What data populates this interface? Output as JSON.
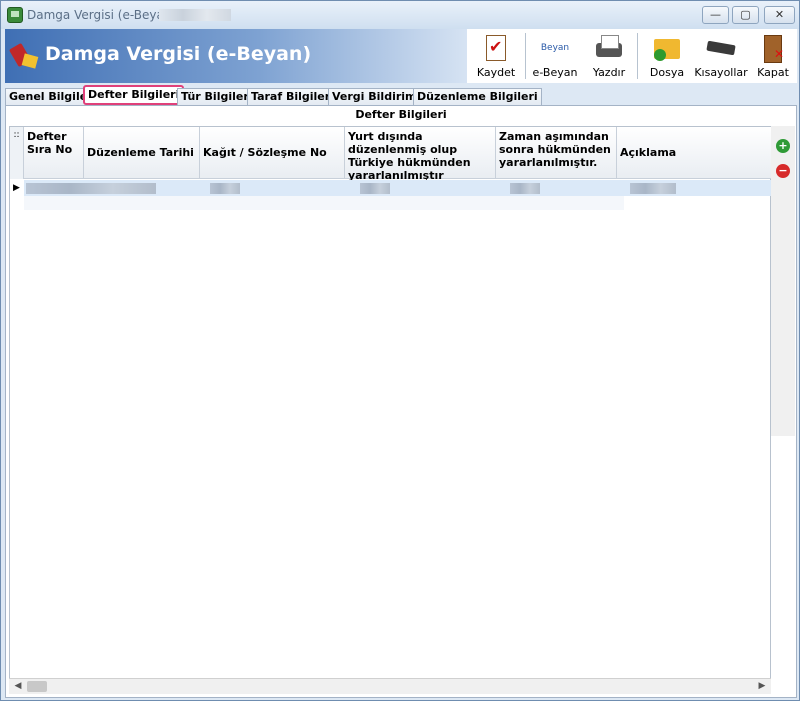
{
  "window": {
    "title": "Damga Vergisi (e-Beyan)",
    "min_glyph": "—",
    "max_glyph": "▢",
    "close_glyph": "✕"
  },
  "banner": {
    "title": "Damga Vergisi (e-Beyan)"
  },
  "toolbar": {
    "items": [
      {
        "label": "Kaydet",
        "icon": "save-icon"
      },
      {
        "label": "e-Beyan",
        "icon": "ebeyan-icon",
        "icon_text": "Beyan"
      },
      {
        "label": "Yazdır",
        "icon": "printer-icon"
      },
      {
        "label": "Dosya",
        "icon": "folder-icon"
      },
      {
        "label": "Kısayollar",
        "icon": "keyboard-icon"
      },
      {
        "label": "Kapat",
        "icon": "exit-icon"
      }
    ]
  },
  "tabs": [
    {
      "label": "Genel Bilgiler"
    },
    {
      "label": "Defter Bilgileri",
      "active": true
    },
    {
      "label": "Tür Bilgileri"
    },
    {
      "label": "Taraf Bilgileri"
    },
    {
      "label": "Vergi Bildirimi"
    },
    {
      "label": "Düzenleme Bilgileri"
    }
  ],
  "section": {
    "title": "Defter Bilgileri"
  },
  "grid": {
    "corner": "::",
    "columns": [
      "Defter Sıra No",
      "Düzenleme Tarihi",
      "Kağıt / Sözleşme No",
      "Yurt dışında düzenlenmiş olup Türkiye hükmünden yararlanılmıştır",
      "Zaman aşımından sonra hükmünden yararlanılmıştır.",
      "Açıklama"
    ],
    "row_indicator": "▶"
  },
  "side_buttons": {
    "add": "+",
    "remove": "−"
  },
  "scroll": {
    "left": "◀",
    "right": "▶"
  },
  "colors": {
    "accent_tab_border": "#e0407a",
    "banner": "#3f6fb4",
    "selected_row": "#dbe9f8"
  }
}
